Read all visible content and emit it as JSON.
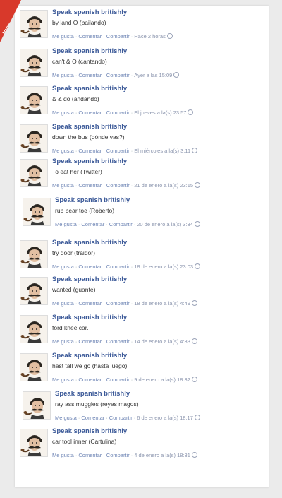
{
  "watermark": "VISTOENFB.COM",
  "actions": {
    "like": "Me gusta",
    "comment": "Comentar",
    "share": "Compartir"
  },
  "posts": [
    {
      "name": "Speak spanish britishly",
      "text": "by land O (bailando)",
      "time": "Hace 2 horas"
    },
    {
      "name": "Speak spanish britishly",
      "text": "can't & O (cantando)",
      "time": "Ayer a las 15:09"
    },
    {
      "name": "Speak spanish britishly",
      "text": "& & do (andando)",
      "time": "El jueves a la(s) 23:57"
    },
    {
      "name": "Speak spanish britishly",
      "text": "down the bus (dónde vas?)",
      "time": "El miércoles a la(s) 3:11"
    },
    {
      "name": "Speak spanish britishly",
      "text": "To eat her (Twitter)",
      "time": "21 de enero a la(s) 23:15"
    },
    {
      "name": "Speak spanish britishly",
      "text": "rub bear toe (Roberto)",
      "time": "20 de enero a la(s) 3:34"
    },
    {
      "name": "Speak spanish britishly",
      "text": "try door (traidor)",
      "time": "18 de enero a la(s) 23:03"
    },
    {
      "name": "Speak spanish britishly",
      "text": "wanted (guante)",
      "time": "18 de enero a la(s) 4:49"
    },
    {
      "name": "Speak spanish britishly",
      "text": "ford knee car.",
      "time": "14 de enero a la(s) 4:33"
    },
    {
      "name": "Speak spanish britishly",
      "text": "hast tall we go (hasta luego)",
      "time": "9 de enero a la(s) 18:32"
    },
    {
      "name": "Speak spanish britishly",
      "text": "ray ass muggles (reyes magos)",
      "time": "6 de enero a la(s) 18:17"
    },
    {
      "name": "Speak spanish britishly",
      "text": "car tool inner (Cartulina)",
      "time": "4 de enero a la(s) 18:31"
    }
  ]
}
